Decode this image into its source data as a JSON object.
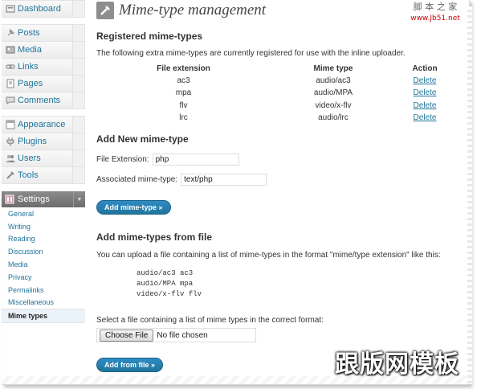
{
  "sidebar": {
    "group1": [
      {
        "label": "Dashboard",
        "icon": "dashboard-icon"
      }
    ],
    "group2": [
      {
        "label": "Posts",
        "icon": "pin-icon"
      },
      {
        "label": "Media",
        "icon": "media-icon"
      },
      {
        "label": "Links",
        "icon": "link-icon"
      },
      {
        "label": "Pages",
        "icon": "page-icon"
      },
      {
        "label": "Comments",
        "icon": "comment-icon"
      }
    ],
    "group3": [
      {
        "label": "Appearance",
        "icon": "appearance-icon"
      },
      {
        "label": "Plugins",
        "icon": "plug-icon"
      },
      {
        "label": "Users",
        "icon": "users-icon"
      },
      {
        "label": "Tools",
        "icon": "tools-icon"
      }
    ],
    "settings_label": "Settings",
    "submenu": [
      "General",
      "Writing",
      "Reading",
      "Discussion",
      "Media",
      "Privacy",
      "Permalinks",
      "Miscellaneous",
      "Mime types"
    ]
  },
  "main": {
    "title": "Mime-type management",
    "registered": {
      "heading": "Registered mime-types",
      "description": "The following extra mime-types are currently registered for use with the inline uploader.",
      "columns": [
        "File extension",
        "Mime type",
        "Action"
      ],
      "rows": [
        {
          "ext": "ac3",
          "mime": "audio/ac3",
          "action": "Delete"
        },
        {
          "ext": "mpa",
          "mime": "audio/MPA",
          "action": "Delete"
        },
        {
          "ext": "flv",
          "mime": "video/x-flv",
          "action": "Delete"
        },
        {
          "ext": "lrc",
          "mime": "audio/lrc",
          "action": "Delete"
        }
      ]
    },
    "add_new": {
      "heading": "Add New mime-type",
      "ext_label": "File Extension:",
      "ext_value": "php",
      "mime_label": "Associated mime-type:",
      "mime_value": "text/php",
      "button": "Add mime-type »"
    },
    "from_file": {
      "heading": "Add mime-types from file",
      "description": "You can upload a file containing a list of mime-types in the format \"mime/type extension\" like this:",
      "sample": "audio/ac3 ac3\naudio/MPA mpa\nvideo/x-flv flv",
      "select_label": "Select a file containing a list of mime types in the correct format:",
      "choose_button": "Choose File",
      "no_file": "No file chosen",
      "button": "Add from file »"
    }
  },
  "watermarks": {
    "top_line1": "脚 本 之 家",
    "top_line2": "www.Jb51.net",
    "bottom": "跟版网模板"
  }
}
